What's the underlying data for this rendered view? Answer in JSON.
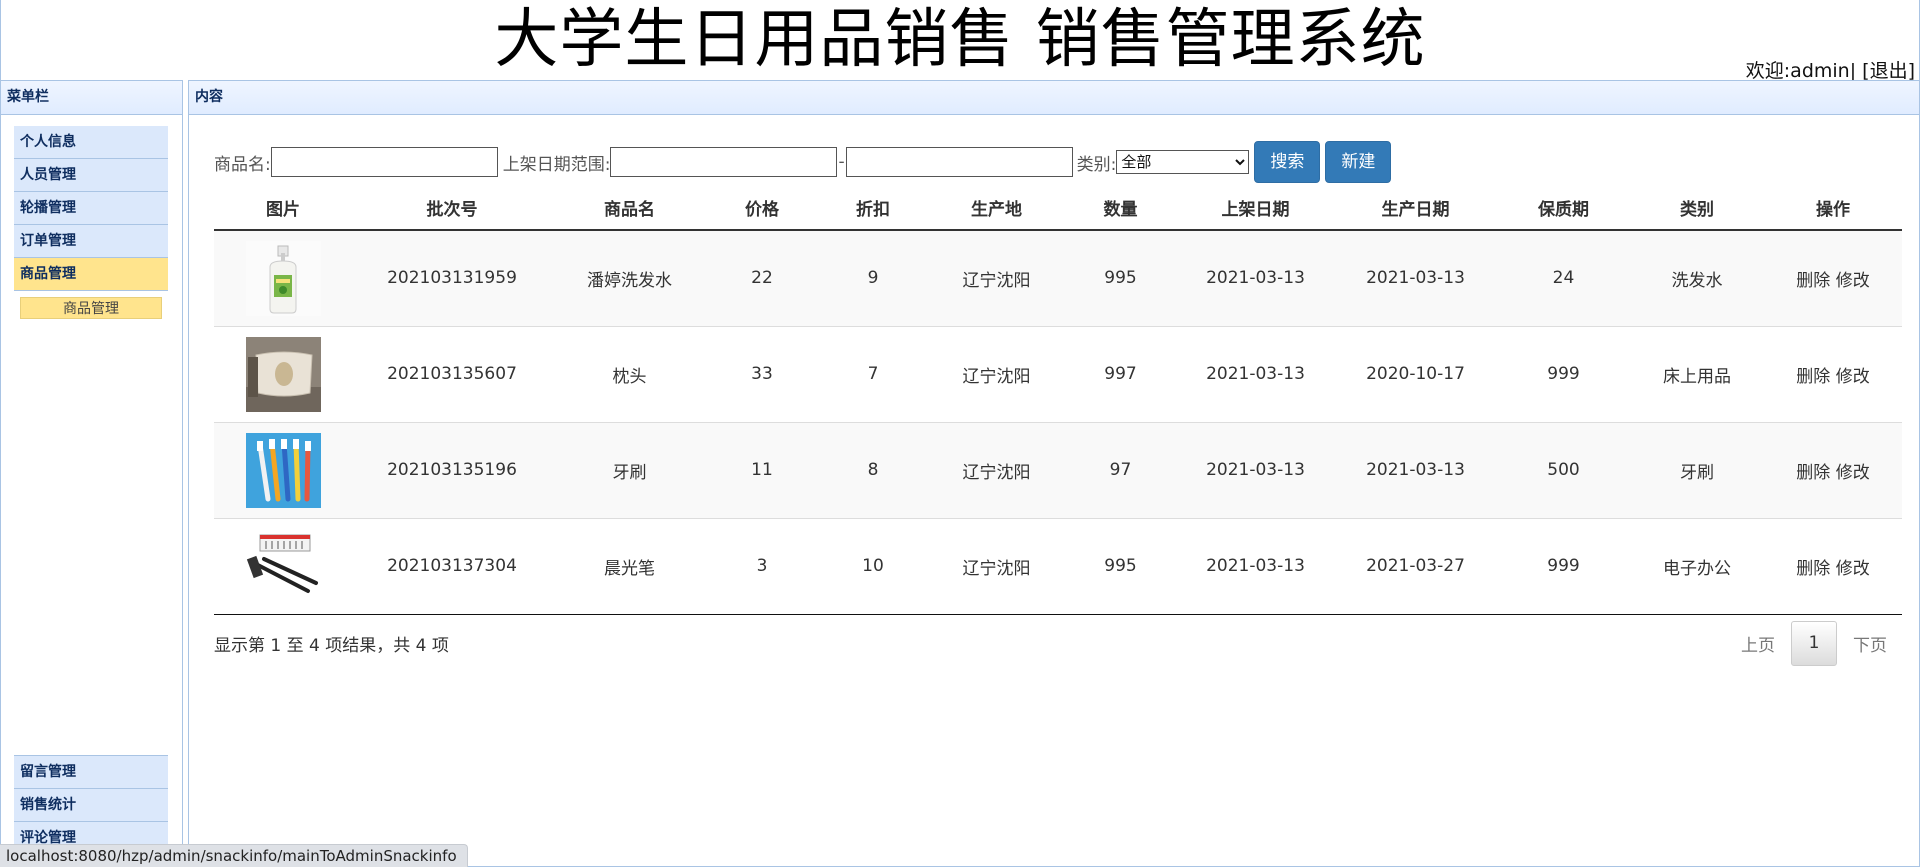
{
  "header": {
    "title": "大学生日用品销售 销售管理系统",
    "welcome": "欢迎:admin|",
    "logout": "[退出]"
  },
  "sidebar": {
    "title": "菜单栏",
    "items": [
      {
        "label": "个人信息"
      },
      {
        "label": "人员管理"
      },
      {
        "label": "轮播管理"
      },
      {
        "label": "订单管理"
      },
      {
        "label": "商品管理",
        "active": true
      }
    ],
    "submenu": {
      "label": "商品管理"
    },
    "bottom_items": [
      {
        "label": "留言管理"
      },
      {
        "label": "销售统计"
      },
      {
        "label": "评论管理"
      }
    ]
  },
  "content": {
    "title": "内容"
  },
  "search": {
    "name_label": "商品名:",
    "name_value": "",
    "date_label": "上架日期范围:",
    "date_from": "",
    "date_sep": "-",
    "date_to": "",
    "category_label": "类别:",
    "category_selected": "全部",
    "search_button": "搜索",
    "new_button": "新建"
  },
  "table": {
    "headers": [
      "图片",
      "批次号",
      "商品名",
      "价格",
      "折扣",
      "生产地",
      "数量",
      "上架日期",
      "生产日期",
      "保质期",
      "类别",
      "操作"
    ],
    "rows": [
      {
        "image": "shampoo-bottle-image",
        "batch": "202103131959",
        "name": "潘婷洗发水",
        "price": "22",
        "discount": "9",
        "origin": "辽宁沈阳",
        "qty": "995",
        "listed": "2021-03-13",
        "produced": "2021-03-13",
        "shelf": "24",
        "category": "洗发水",
        "del": "删除",
        "edit": "修改"
      },
      {
        "image": "pillow-image",
        "batch": "202103135607",
        "name": "枕头",
        "price": "33",
        "discount": "7",
        "origin": "辽宁沈阳",
        "qty": "997",
        "listed": "2021-03-13",
        "produced": "2020-10-17",
        "shelf": "999",
        "category": "床上用品",
        "del": "删除",
        "edit": "修改"
      },
      {
        "image": "toothbrush-image",
        "batch": "202103135196",
        "name": "牙刷",
        "price": "11",
        "discount": "8",
        "origin": "辽宁沈阳",
        "qty": "97",
        "listed": "2021-03-13",
        "produced": "2021-03-13",
        "shelf": "500",
        "category": "牙刷",
        "del": "删除",
        "edit": "修改"
      },
      {
        "image": "pen-image",
        "batch": "202103137304",
        "name": "晨光笔",
        "price": "3",
        "discount": "10",
        "origin": "辽宁沈阳",
        "qty": "995",
        "listed": "2021-03-13",
        "produced": "2021-03-27",
        "shelf": "999",
        "category": "电子办公",
        "del": "删除",
        "edit": "修改"
      }
    ]
  },
  "footer": {
    "info": "显示第 1 至 4 项结果，共 4 项",
    "prev": "上页",
    "current": "1",
    "next": "下页"
  },
  "statusbar": {
    "url": "localhost:8080/hzp/admin/snackinfo/mainToAdminSnackinfo"
  },
  "colors": {
    "accent": "#337ab7",
    "active_menu": "#ffe48d",
    "menu_bg": "#dbe8fb"
  }
}
